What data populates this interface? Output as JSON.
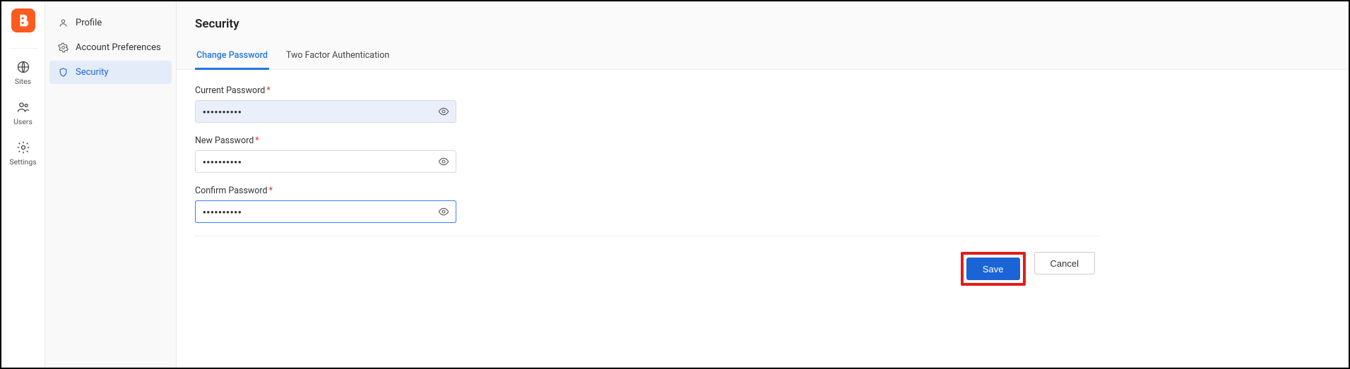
{
  "rail": {
    "items": [
      {
        "label": "Sites"
      },
      {
        "label": "Users"
      },
      {
        "label": "Settings"
      }
    ]
  },
  "sidebar": {
    "items": [
      {
        "label": "Profile"
      },
      {
        "label": "Account Preferences"
      },
      {
        "label": "Security"
      }
    ]
  },
  "header": {
    "title": "Security",
    "tabs": [
      {
        "label": "Change Password"
      },
      {
        "label": "Two Factor Authentication"
      }
    ]
  },
  "form": {
    "current_password": {
      "label": "Current Password",
      "value": "••••••••••"
    },
    "new_password": {
      "label": "New Password",
      "value": "••••••••••"
    },
    "confirm_password": {
      "label": "Confirm Password",
      "value": "••••••••••"
    },
    "required_mark": "*"
  },
  "actions": {
    "save_label": "Save",
    "cancel_label": "Cancel"
  }
}
